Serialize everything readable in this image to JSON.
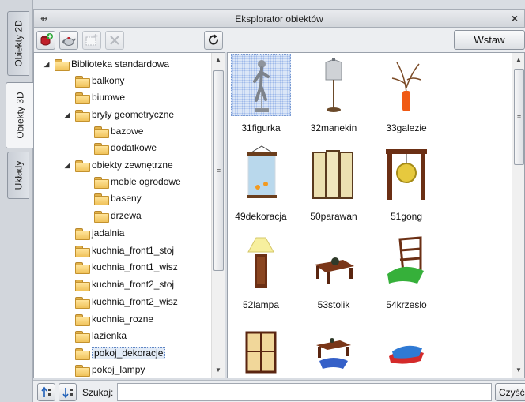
{
  "vertical_tabs": [
    {
      "label": "Obiekty 2D",
      "active": false
    },
    {
      "label": "Obiekty 3D",
      "active": true
    },
    {
      "label": "Układy",
      "active": false
    }
  ],
  "window": {
    "title": "Eksplorator obiektów",
    "close_glyph": "×"
  },
  "toolbar": {
    "insert_label": "Wstaw",
    "icons": [
      "add-object-icon",
      "teapot-icon",
      "new-folder-icon",
      "delete-icon",
      "refresh-icon"
    ]
  },
  "tree": {
    "items": [
      {
        "label": "Biblioteka standardowa",
        "expand": "◢",
        "selected": false
      },
      {
        "label": "balkony",
        "expand": "",
        "selected": false
      },
      {
        "label": "biurowe",
        "expand": "",
        "selected": false
      },
      {
        "label": "bryły geometryczne",
        "expand": "◢",
        "selected": false
      },
      {
        "label": "bazowe",
        "expand": "",
        "selected": false
      },
      {
        "label": "dodatkowe",
        "expand": "",
        "selected": false
      },
      {
        "label": "obiekty zewnętrzne",
        "expand": "◢",
        "selected": false
      },
      {
        "label": "meble ogrodowe",
        "expand": "",
        "selected": false
      },
      {
        "label": "baseny",
        "expand": "",
        "selected": false
      },
      {
        "label": "drzewa",
        "expand": "",
        "selected": false
      },
      {
        "label": "jadalnia",
        "expand": "",
        "selected": false
      },
      {
        "label": "kuchnia_front1_stoj",
        "expand": "",
        "selected": false
      },
      {
        "label": "kuchnia_front1_wisz",
        "expand": "",
        "selected": false
      },
      {
        "label": "kuchnia_front2_stoj",
        "expand": "",
        "selected": false
      },
      {
        "label": "kuchnia_front2_wisz",
        "expand": "",
        "selected": false
      },
      {
        "label": "kuchnia_rozne",
        "expand": "",
        "selected": false
      },
      {
        "label": "lazienka",
        "expand": "",
        "selected": false
      },
      {
        "label": "pokoj_dekoracje",
        "expand": "",
        "selected": true
      },
      {
        "label": "pokoj_lampy",
        "expand": "",
        "selected": false
      }
    ]
  },
  "objects": [
    {
      "label": "31figurka",
      "icon": "figurine-icon",
      "selected": true
    },
    {
      "label": "32manekin",
      "icon": "mannequin-icon",
      "selected": false
    },
    {
      "label": "33galezie",
      "icon": "branches-vase-icon",
      "selected": false
    },
    {
      "label": "49dekoracja",
      "icon": "wall-scroll-icon",
      "selected": false
    },
    {
      "label": "50parawan",
      "icon": "folding-screen-icon",
      "selected": false
    },
    {
      "label": "51gong",
      "icon": "gong-icon",
      "selected": false
    },
    {
      "label": "52lampa",
      "icon": "table-lamp-icon",
      "selected": false
    },
    {
      "label": "53stolik",
      "icon": "low-table-icon",
      "selected": false
    },
    {
      "label": "54krzeslo",
      "icon": "floor-chair-icon",
      "selected": false
    },
    {
      "label": "",
      "icon": "lantern-cabinet-icon",
      "selected": false
    },
    {
      "label": "",
      "icon": "tea-set-icon",
      "selected": false
    },
    {
      "label": "",
      "icon": "cushions-icon",
      "selected": false
    }
  ],
  "search": {
    "label": "Szukaj:",
    "value": "",
    "clear_label": "Wyczyść",
    "clear_visible": "Czyść"
  },
  "colors": {
    "panel_bg": "#ffffff",
    "chrome_bg": "#d9dde3",
    "selection": "#dbe6f7",
    "folder": "#f0c25a"
  }
}
